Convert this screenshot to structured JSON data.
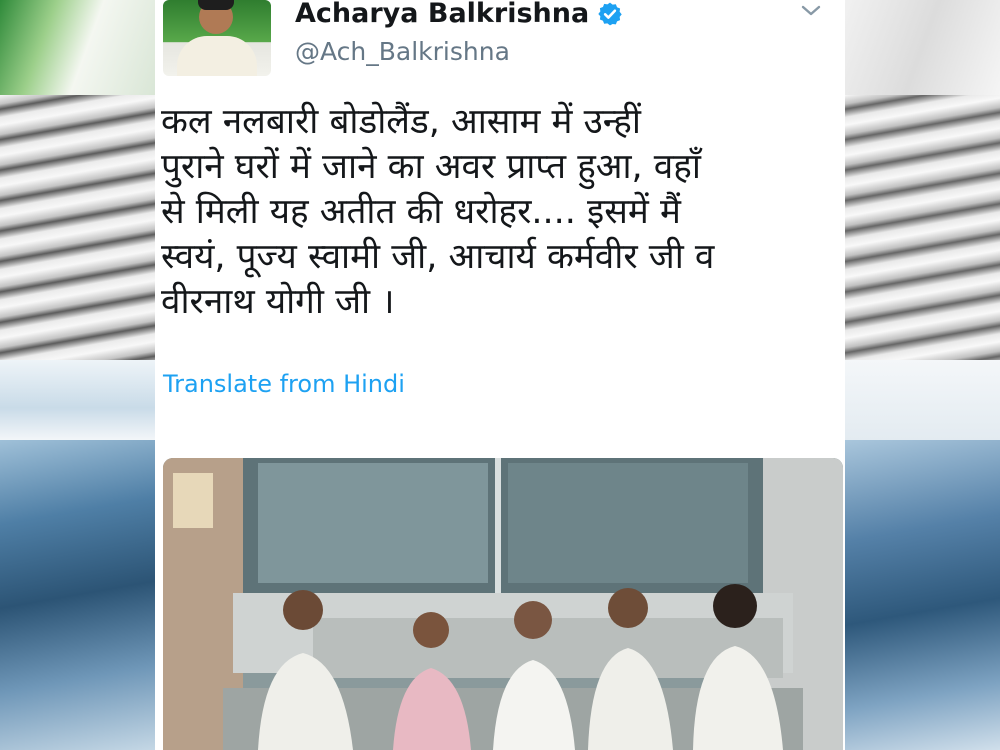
{
  "tweet": {
    "display_name": "Acharya Balkrishna",
    "handle": "@Ach_Balkrishna",
    "text": "कल नलबारी बोडोलैंड, आसाम में उन्हीं\nपुराने घरों में जाने का अवर प्राप्त हुआ, वहाँ\nसे मिली यह अतीत की धरोहर.... इसमें मैं\nस्वयं, पूज्य स्वामी जी, आचार्य कर्मवीर जी व\nवीरनाथ योगी जी ।",
    "translate_label": "Translate from Hindi"
  },
  "icons": {
    "verified": "verified-badge-icon",
    "caret": "chevron-down-icon"
  },
  "colors": {
    "name": "#14171a",
    "handle": "#657786",
    "link": "#1da1f2",
    "verified": "#1da1f2"
  }
}
